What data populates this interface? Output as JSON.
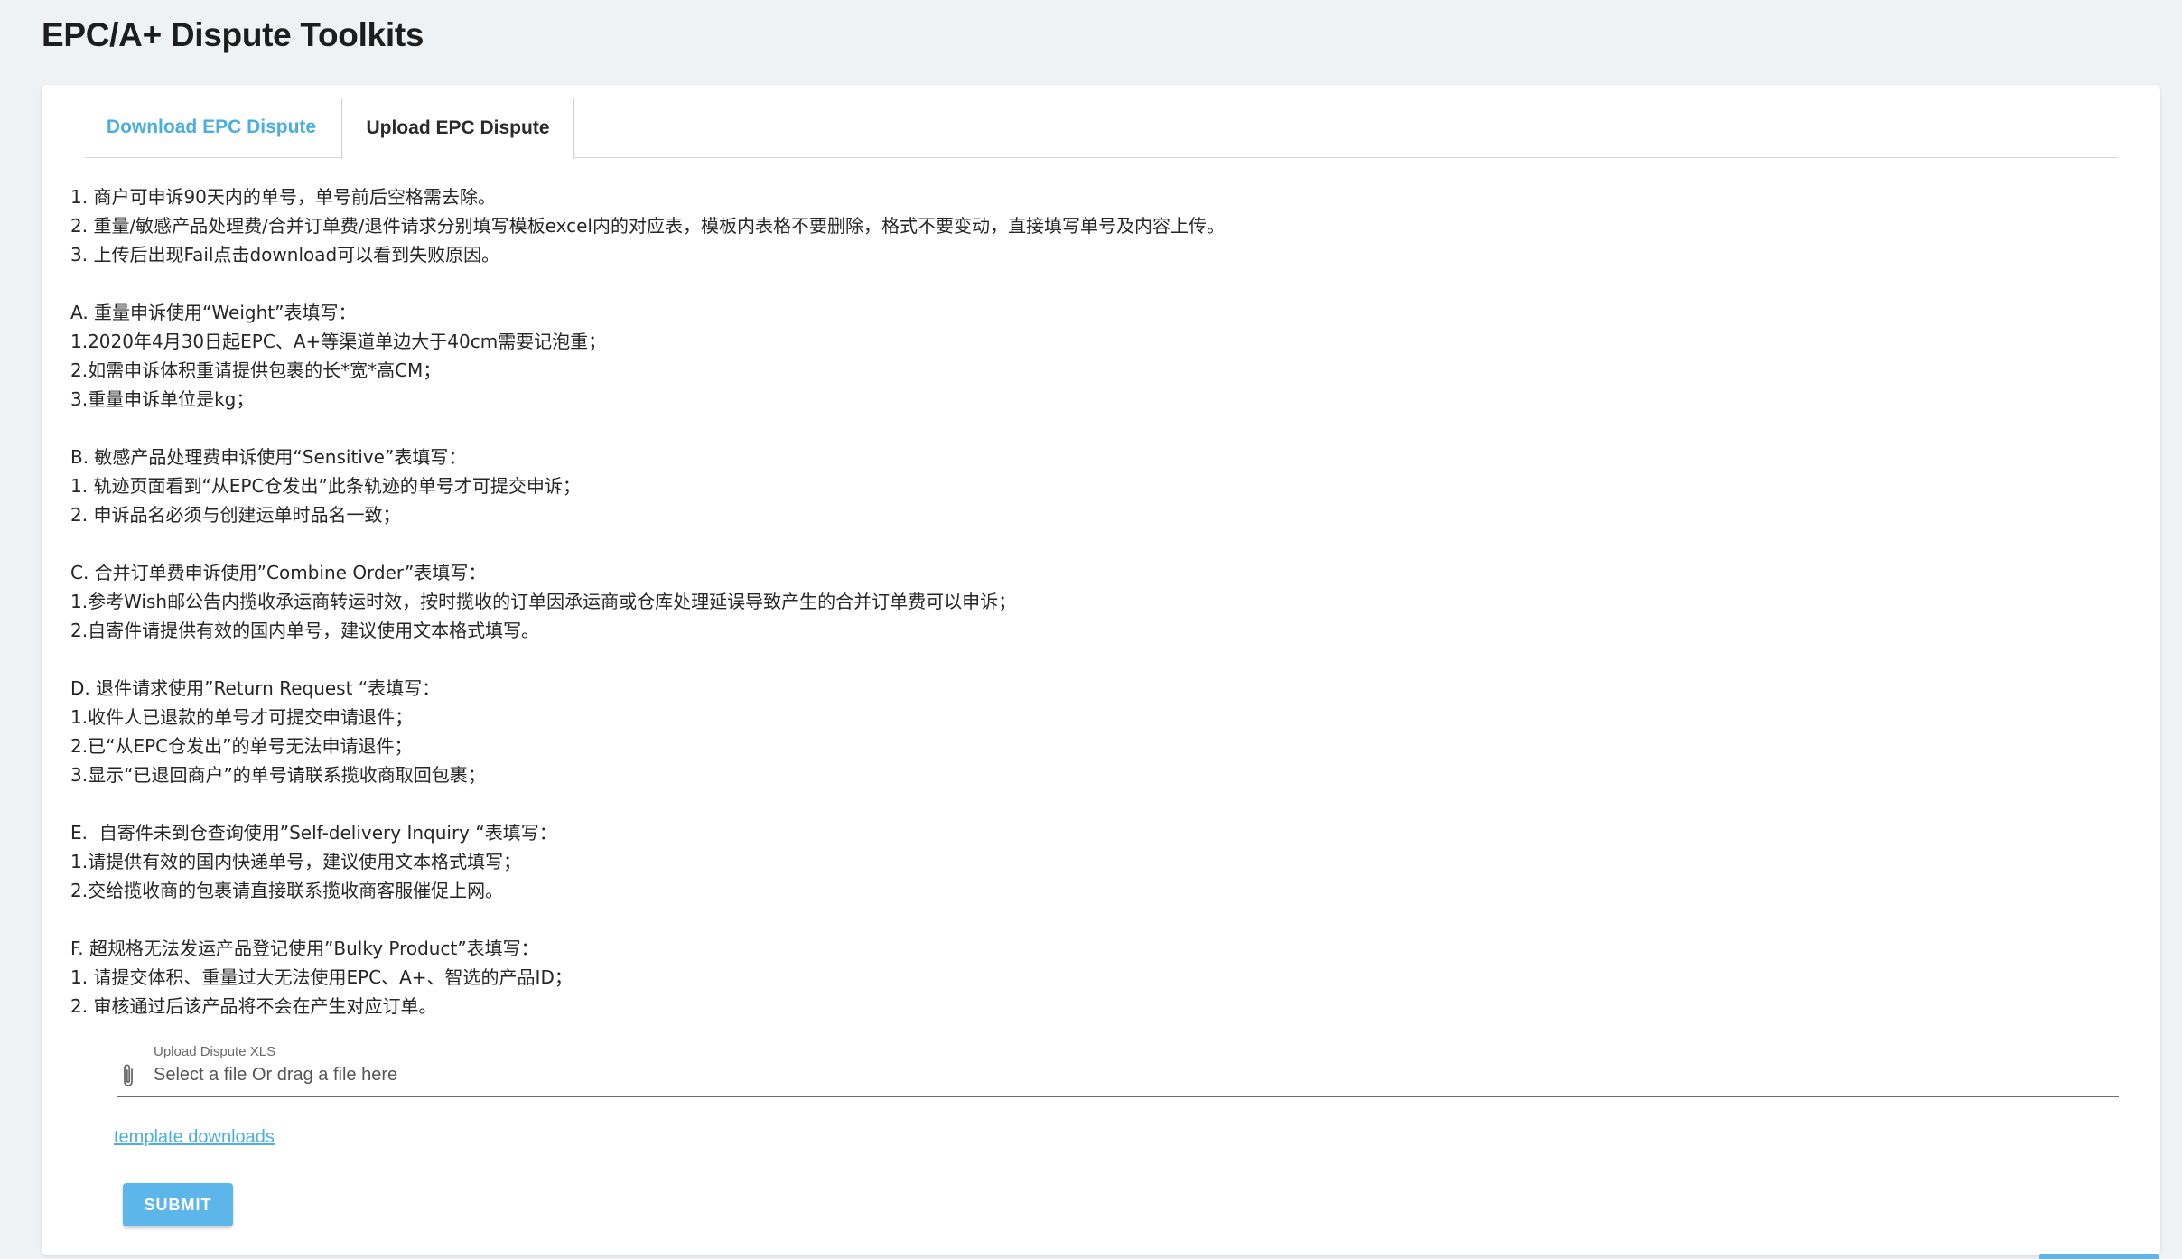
{
  "page": {
    "title": "EPC/A+ Dispute Toolkits"
  },
  "tabs": [
    {
      "label": "Download EPC Dispute",
      "active": false
    },
    {
      "label": "Upload EPC Dispute",
      "active": true
    }
  ],
  "instructions": {
    "lines": [
      "1. 商户可申诉90天内的单号，单号前后空格需去除。",
      "2. 重量/敏感产品处理费/合并订单费/退件请求分别填写模板excel内的对应表，模板内表格不要删除，格式不要变动，直接填写单号及内容上传。",
      "3. 上传后出现Fail点击download可以看到失败原因。",
      "",
      "A. 重量申诉使用“Weight”表填写：",
      "1.2020年4月30日起EPC、A+等渠道单边大于40cm需要记泡重；",
      "2.如需申诉体积重请提供包裹的长*宽*高CM；",
      "3.重量申诉单位是kg；",
      "",
      "B. 敏感产品处理费申诉使用“Sensitive”表填写：",
      "1. 轨迹页面看到“从EPC仓发出”此条轨迹的单号才可提交申诉；",
      "2. 申诉品名必须与创建运单时品名一致；",
      "",
      "C. 合并订单费申诉使用”Combine Order”表填写：",
      "1.参考Wish邮公告内揽收承运商转运时效，按时揽收的订单因承运商或仓库处理延误导致产生的合并订单费可以申诉；",
      "2.自寄件请提供有效的国内单号，建议使用文本格式填写。",
      "",
      "D. 退件请求使用”Return Request “表填写：",
      "1.收件人已退款的单号才可提交申请退件；",
      "2.已“从EPC仓发出”的单号无法申请退件；",
      "3.显示“已退回商户”的单号请联系揽收商取回包裹；",
      "",
      "E.  自寄件未到仓查询使用”Self-delivery Inquiry “表填写：",
      "1.请提供有效的国内快递单号，建议使用文本格式填写；",
      "2.交给揽收商的包裹请直接联系揽收商客服催促上网。",
      "",
      "F. 超规格无法发运产品登记使用”Bulky Product”表填写：",
      "1. 请提交体积、重量过大无法使用EPC、A+、智选的产品ID；",
      "2. 审核通过后该产品将不会在产生对应订单。"
    ]
  },
  "upload": {
    "label": "Upload Dispute XLS",
    "placeholder": "Select a file Or drag a file here",
    "icon": "paperclip-icon"
  },
  "template_link": "template downloads",
  "submit_label": "SUBMIT",
  "colors": {
    "accent": "#4aaee0",
    "button": "#5cb6ea",
    "background": "#eef2f5"
  }
}
